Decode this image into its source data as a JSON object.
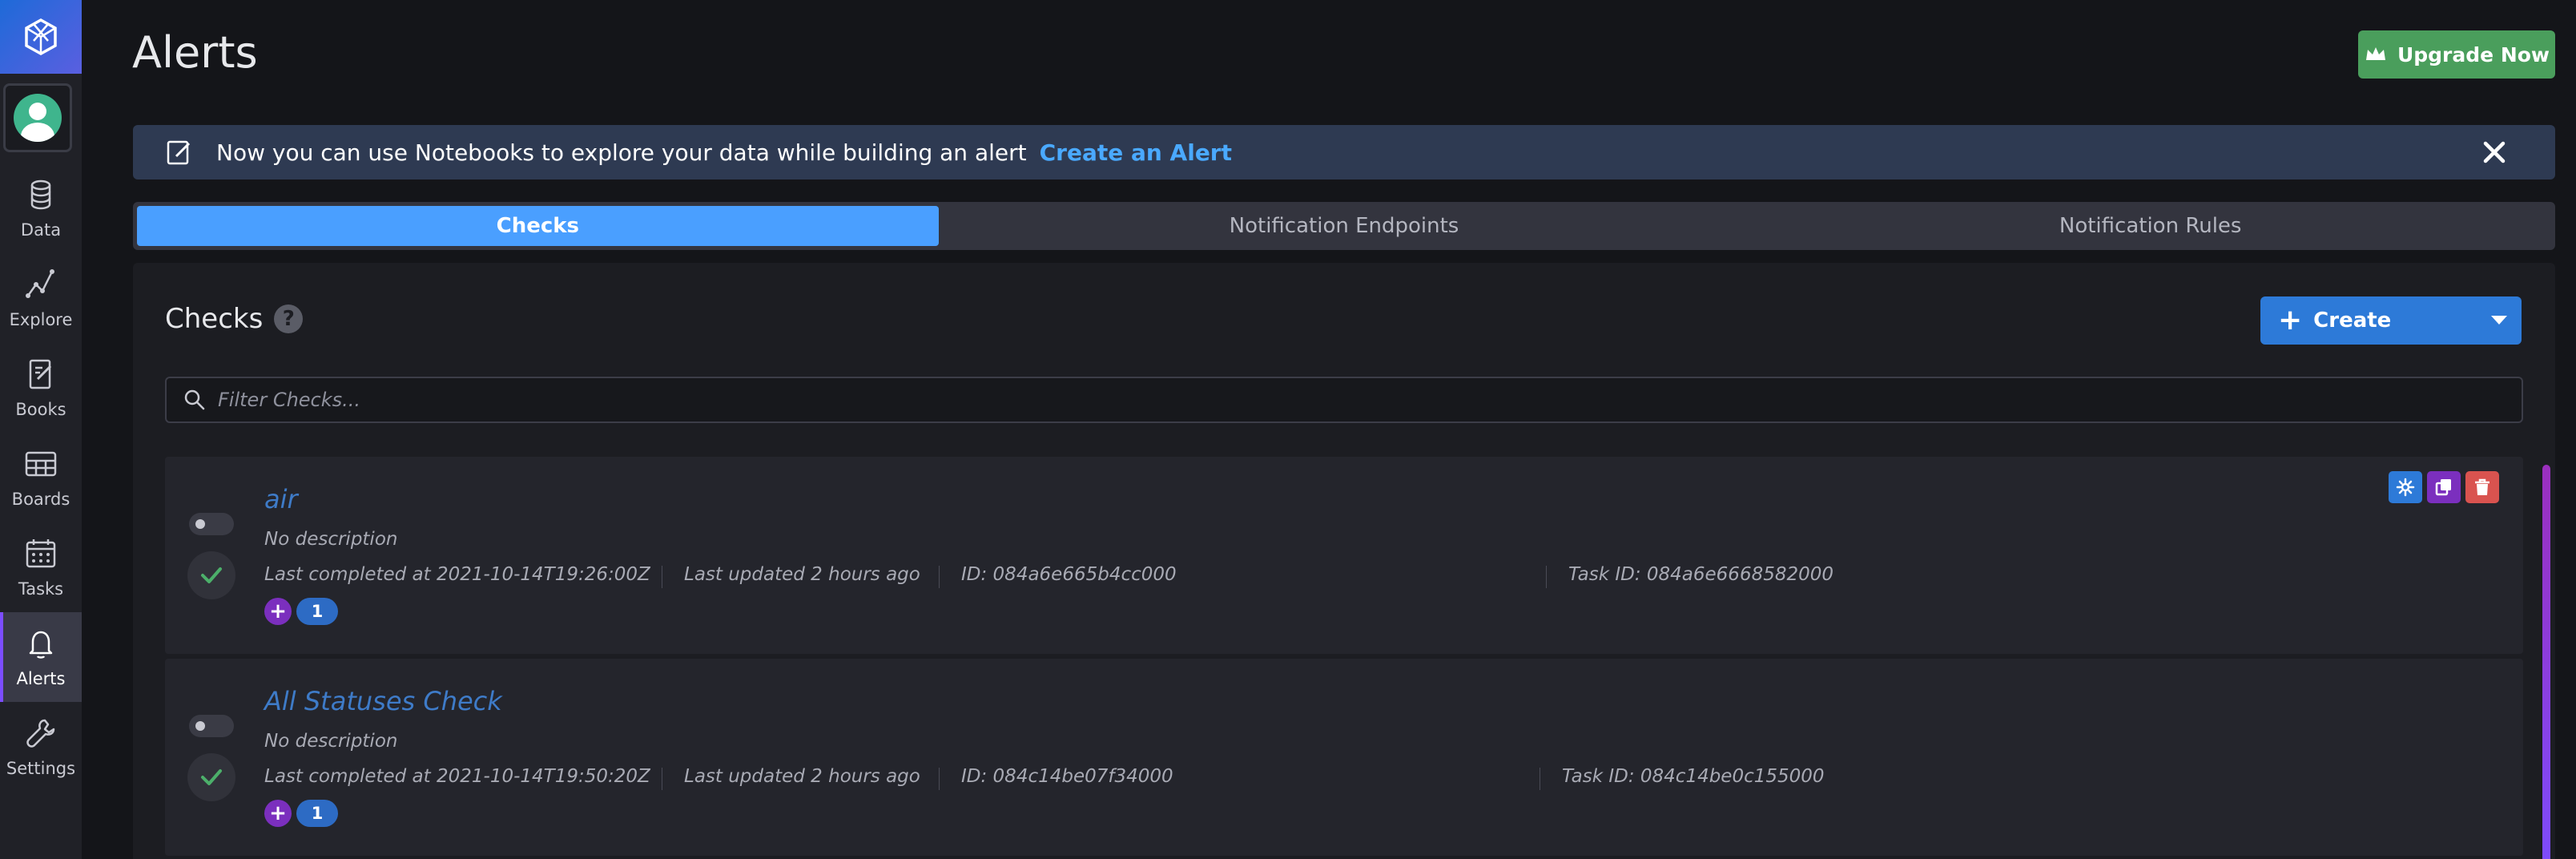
{
  "sidebar": {
    "items": [
      {
        "label": "Data",
        "icon": "database-icon"
      },
      {
        "label": "Explore",
        "icon": "explore-graph-icon"
      },
      {
        "label": "Books",
        "icon": "notebook-icon"
      },
      {
        "label": "Boards",
        "icon": "dashboard-grid-icon"
      },
      {
        "label": "Tasks",
        "icon": "calendar-icon"
      },
      {
        "label": "Alerts",
        "icon": "bell-icon",
        "active": true
      },
      {
        "label": "Settings",
        "icon": "wrench-icon"
      }
    ]
  },
  "header": {
    "title": "Alerts",
    "upgrade_label": "Upgrade Now"
  },
  "banner": {
    "text": "Now you can use Notebooks to explore your data while building an alert",
    "link": "Create an Alert"
  },
  "tabs": [
    {
      "label": "Checks",
      "active": true
    },
    {
      "label": "Notification Endpoints",
      "active": false
    },
    {
      "label": "Notification Rules",
      "active": false
    }
  ],
  "panel": {
    "title": "Checks",
    "help": "?",
    "create_label": "Create",
    "filter_placeholder": "Filter Checks..."
  },
  "checks": [
    {
      "name": "air",
      "description": "No description",
      "last_completed": "Last completed at 2021-10-14T19:26:00Z",
      "last_updated": "Last updated 2 hours ago",
      "id": "ID: 084a6e665b4cc000",
      "task_id": "Task ID: 084a6e6668582000",
      "label_add": "+",
      "label_count": "1"
    },
    {
      "name": "All Statuses Check",
      "description": "No description",
      "last_completed": "Last completed at 2021-10-14T19:50:20Z",
      "last_updated": "Last updated 2 hours ago",
      "id": "ID: 084c14be07f34000",
      "task_id": "Task ID: 084c14be0c155000",
      "label_add": "+",
      "label_count": "1"
    }
  ],
  "colors": {
    "accent": "#4a9fff",
    "upgrade": "#4a9e5c",
    "check_ok": "#4caf6a",
    "delete": "#d9534f",
    "clone": "#7b2fbe"
  }
}
